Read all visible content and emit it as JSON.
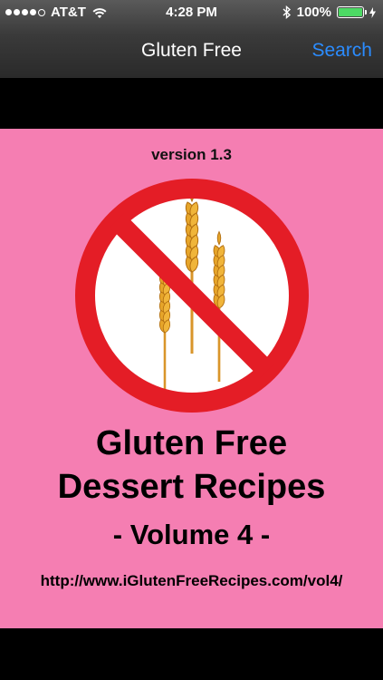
{
  "status_bar": {
    "carrier": "AT&T",
    "time": "4:28 PM",
    "battery_percent": "100%",
    "signal_bars_filled": 4,
    "signal_bars_total": 5
  },
  "nav": {
    "title": "Gluten Free",
    "search_label": "Search"
  },
  "cover": {
    "version": "version 1.3",
    "title_line1": "Gluten Free",
    "title_line2": "Dessert Recipes",
    "volume": "- Volume 4 -",
    "url": "http://www.iGlutenFreeRecipes.com/vol4/",
    "background_color": "#f57eb2",
    "logo_icon": "no-gluten-wheat-icon"
  },
  "colors": {
    "accent": "#2b8cff",
    "prohibition_red": "#e41d26",
    "wheat_gold": "#e6a52a"
  }
}
